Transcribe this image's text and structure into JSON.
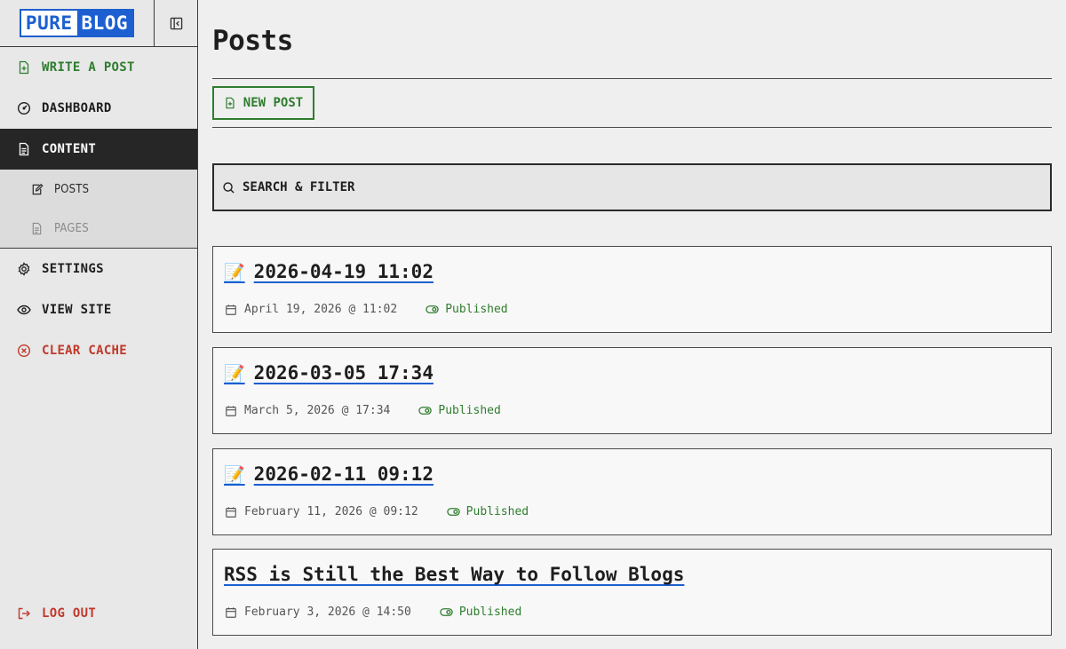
{
  "brand": {
    "part1": "PURE",
    "part2": "BLOG"
  },
  "sidebar": {
    "items": [
      {
        "label": "WRITE A POST"
      },
      {
        "label": "DASHBOARD"
      },
      {
        "label": "CONTENT"
      },
      {
        "label": "SETTINGS"
      },
      {
        "label": "VIEW SITE"
      },
      {
        "label": "CLEAR CACHE"
      }
    ],
    "subitems": [
      {
        "label": "POSTS"
      },
      {
        "label": "PAGES"
      }
    ],
    "logout": "LOG OUT"
  },
  "main": {
    "title": "Posts",
    "new_post_label": "NEW POST",
    "filter_label": "SEARCH & FILTER"
  },
  "posts": [
    {
      "emoji": "📝",
      "title": "2026-04-19 11:02",
      "date": "April 19, 2026 @ 11:02",
      "status": "Published"
    },
    {
      "emoji": "📝",
      "title": "2026-03-05 17:34",
      "date": "March 5, 2026 @ 17:34",
      "status": "Published"
    },
    {
      "emoji": "📝",
      "title": "2026-02-11 09:12",
      "date": "February 11, 2026 @ 09:12",
      "status": "Published"
    },
    {
      "emoji": "",
      "title": "RSS is Still the Best Way to Follow Blogs",
      "date": "February 3, 2026 @ 14:50",
      "status": "Published"
    }
  ],
  "colors": {
    "brand_blue": "#1d5fd0",
    "accent_green": "#2f7d2f",
    "danger_red": "#c0392b",
    "active_bg": "#262626"
  }
}
